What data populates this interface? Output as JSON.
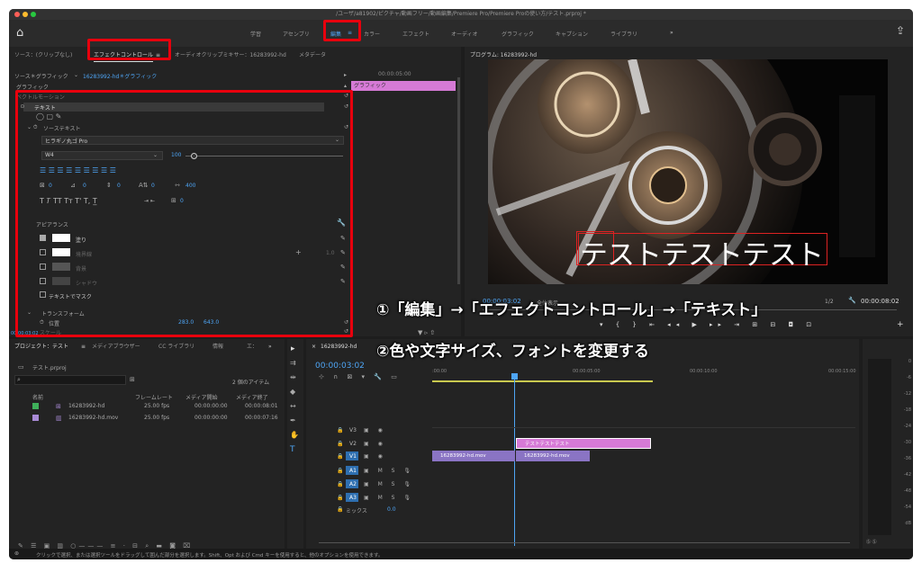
{
  "title": "/ユーザ/a81902/ピクチャ/動画フリー/動画編集/Premiere Pro/Premiere Proの使い方/テスト.prproj *",
  "workspaces": [
    "学習",
    "アセンブリ",
    "編集",
    "カラー",
    "エフェクト",
    "オーディオ",
    "グラフィック",
    "キャプション",
    "ライブラリ",
    "»"
  ],
  "source_tabs": [
    "ソース：(クリップなし)",
    "エフェクトコントロール",
    "オーディオクリップミキサー：16283992-hd",
    "メタデータ"
  ],
  "ec": {
    "path": "ソース＊グラフィック",
    "seq": "16283992-hd＊グラフィック",
    "timecode": "00:00:05:00",
    "graphic": "グラフィック",
    "clip_label": "グラフィック",
    "vector_motion": "ベクトルモーション",
    "text": "テキスト",
    "source_text": "ソーステキスト",
    "font": "ヒラギノ丸ゴ Pro",
    "weight": "W4",
    "size": "100",
    "kern": "0",
    "track": "0",
    "lead": "0",
    "baseline": "0",
    "tsume": "400",
    "tab": "0",
    "appearance": "アピアランス",
    "fill": "塗り",
    "stroke": "境界線",
    "stroke_val": "1.0",
    "bg": "背景",
    "shadow": "シャドウ",
    "mask": "テキストでマスク",
    "transform": "トランスフォーム",
    "position": "位置",
    "pos_x": "283.0",
    "pos_y": "643.0",
    "scale": "スケール",
    "current_time": "00:00:03:02"
  },
  "program": {
    "label": "プログラム: 16283992-hd",
    "caption": "テストテストテスト",
    "timecode": "00:00:03:02",
    "fit": "全体表示",
    "res": "1/2",
    "duration": "00:00:08:02"
  },
  "annotations": {
    "a1": "①「編集」→「エフェクトコントロール」→「テキスト」",
    "a2": "②色や文字サイズ、フォントを変更する"
  },
  "project": {
    "tabs": [
      "プロジェクト：テスト",
      "メディアブラウザー",
      "CC ライブラリ",
      "情報",
      "エ：",
      "»"
    ],
    "file": "テスト.prproj",
    "items_count": "2 個のアイテム",
    "cols": [
      "名前",
      "フレームレート",
      "メディア開始",
      "メディア終了"
    ],
    "rows": [
      {
        "name": "16283992-hd",
        "fps": "25.00 fps",
        "start": "00:00:00:00",
        "end": "00:00:08:01",
        "color": "#3fb05a"
      },
      {
        "name": "16283992-hd.mov",
        "fps": "25.00 fps",
        "start": "00:00:00:00",
        "end": "00:00:07:16",
        "color": "#a98ad6"
      }
    ]
  },
  "timeline": {
    "tab": "16283992-hd",
    "timecode": "00:00:03:02",
    "ruler": [
      ":00:00",
      "00:00:05:00",
      "00:00:10:00",
      "00:00:15:00"
    ],
    "tracks_v": [
      "V3",
      "V2",
      "V1"
    ],
    "tracks_a": [
      "A1",
      "A2",
      "A3"
    ],
    "mix": "ミックス",
    "mix_val": "0.0",
    "clip_text": "テストテストテスト",
    "clip_v1a": "16283992-hd.mov",
    "clip_v1b": "16283992-hd.mov"
  },
  "meter_ticks": [
    "0",
    "-6",
    "-12",
    "-18",
    "-24",
    "-30",
    "-36",
    "-42",
    "-48",
    "-54",
    "dB"
  ],
  "status": "クリックで選択、または選択ツールをドラッグして囲んだ部分を選択します。Shift、Opt および Cmd キーを使用すると、他のオプションを使用できます。"
}
